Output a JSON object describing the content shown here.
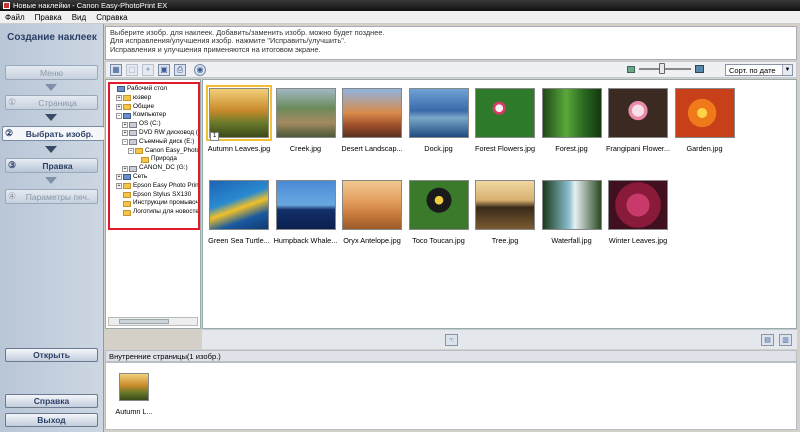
{
  "window": {
    "title": "Новые наклейки - Canon Easy-PhotoPrint EX"
  },
  "menu": [
    "Файл",
    "Правка",
    "Вид",
    "Справка"
  ],
  "left_panel": {
    "title": "Создание наклеек",
    "steps": [
      {
        "num": "",
        "label": "Меню"
      },
      {
        "num": "①",
        "label": "Страница"
      },
      {
        "num": "②",
        "label": "Выбрать изобр."
      },
      {
        "num": "③",
        "label": "Правка"
      },
      {
        "num": "④",
        "label": "Параметры печ."
      }
    ],
    "open_button": "Открыть",
    "help_button": "Справка",
    "exit_button": "Выход"
  },
  "instructions": [
    "Выберите изобр. для наклеек. Добавить/заменить изобр. можно будет позднее.",
    "Для исправления/улучшения изобр. нажмите \"Исправить/улучшить\".",
    "Исправления и улучшения применяются на итоговом экране."
  ],
  "sort": {
    "selected": "Сорт. по дате"
  },
  "tree": [
    {
      "label": "Рабочий стол",
      "indent": 0,
      "icon": "desktop",
      "exp": ""
    },
    {
      "label": "юзвер",
      "indent": 1,
      "icon": "folder",
      "exp": "+"
    },
    {
      "label": "Общие",
      "indent": 1,
      "icon": "folder",
      "exp": "+"
    },
    {
      "label": "Компьютер",
      "indent": 1,
      "icon": "computer",
      "exp": "−"
    },
    {
      "label": "OS (C:)",
      "indent": 2,
      "icon": "drive",
      "exp": "+"
    },
    {
      "label": "DVD RW дисковод (D:)",
      "indent": 2,
      "icon": "drive",
      "exp": "+"
    },
    {
      "label": "Съемный диск (E:)",
      "indent": 2,
      "icon": "drive",
      "exp": "−"
    },
    {
      "label": "Canon Easy_PhotoPrint",
      "indent": 3,
      "icon": "folder",
      "exp": "−"
    },
    {
      "label": "Природа",
      "indent": 4,
      "icon": "folder",
      "exp": ""
    },
    {
      "label": "CANON_DC (G:)",
      "indent": 2,
      "icon": "drive",
      "exp": "+"
    },
    {
      "label": "Сеть",
      "indent": 1,
      "icon": "computer",
      "exp": "+"
    },
    {
      "label": "Epson Easy Photo Print",
      "indent": 1,
      "icon": "folder",
      "exp": "+"
    },
    {
      "label": "Epson Stylus SX130",
      "indent": 1,
      "icon": "folder",
      "exp": ""
    },
    {
      "label": "Инструкции промывочные",
      "indent": 1,
      "icon": "folder",
      "exp": ""
    },
    {
      "label": "Логотипы для новостей",
      "indent": 1,
      "icon": "folder",
      "exp": ""
    }
  ],
  "images": [
    {
      "name": "Autumn Leaves.jpg",
      "selected": true
    },
    {
      "name": "Creek.jpg",
      "selected": false
    },
    {
      "name": "Desert Landscap...",
      "selected": false
    },
    {
      "name": "Dock.jpg",
      "selected": false
    },
    {
      "name": "Forest Flowers.jpg",
      "selected": false
    },
    {
      "name": "Forest.jpg",
      "selected": false
    },
    {
      "name": "Frangipani Flower...",
      "selected": false
    },
    {
      "name": "Garden.jpg",
      "selected": false
    },
    {
      "name": "Green Sea Turtle...",
      "selected": false
    },
    {
      "name": "Humpback Whale...",
      "selected": false
    },
    {
      "name": "Oryx Antelope.jpg",
      "selected": false
    },
    {
      "name": "Toco Toucan.jpg",
      "selected": false
    },
    {
      "name": "Tree.jpg",
      "selected": false
    },
    {
      "name": "Waterfall.jpg",
      "selected": false
    },
    {
      "name": "Winter Leaves.jpg",
      "selected": false
    }
  ],
  "selected_badge": "1",
  "inner_pages": {
    "header": "Внутренние страницы(1 изобр.)",
    "items": [
      {
        "name": "Autumn L..."
      }
    ]
  }
}
